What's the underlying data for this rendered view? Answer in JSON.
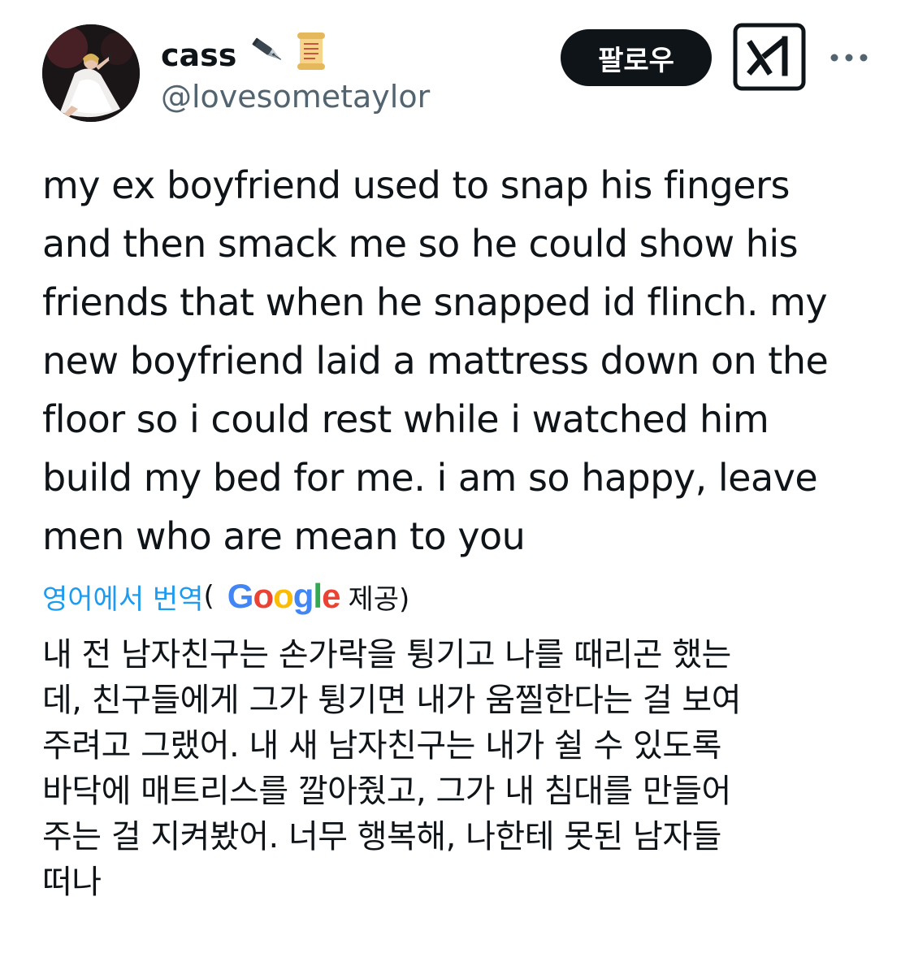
{
  "author": {
    "display_name": "cass",
    "handle": "@lovesometaylor",
    "name_emojis": [
      "pen-nib-emoji",
      "scroll-emoji"
    ]
  },
  "header": {
    "follow_label": "팔로우",
    "grok_icon": "grok-icon",
    "more_icon": "more-icon"
  },
  "tweet": {
    "text": "my ex boyfriend used to snap his fingers\nand then smack me so he could show his\nfriends that when he snapped id flinch. my\nnew boyfriend laid a mattress down on the\nfloor so i could rest while i watched him\nbuild my bed for me. i am so happy, leave\nmen who are mean to you"
  },
  "translation": {
    "link_label": "영어에서 번역",
    "open_paren": "(",
    "provider": "Google",
    "provider_suffix": "제공)",
    "text": "내 전 남자친구는 손가락을 튕기고 나를 때리곤 했는\n데, 친구들에게 그가 튕기면 내가 움찔한다는 걸 보여\n주려고 그랬어. 내 새 남자친구는 내가 쉴 수 있도록\n바닥에 매트리스를 깔아줬고, 그가 내 침대를 만들어\n주는 걸 지켜봤어. 너무 행복해, 나한테 못된 남자들\n떠나"
  },
  "colors": {
    "text_primary": "#0f1419",
    "text_secondary": "#536471",
    "link": "#1d9bf0",
    "button_bg": "#0f1419",
    "button_text": "#ffffff"
  }
}
